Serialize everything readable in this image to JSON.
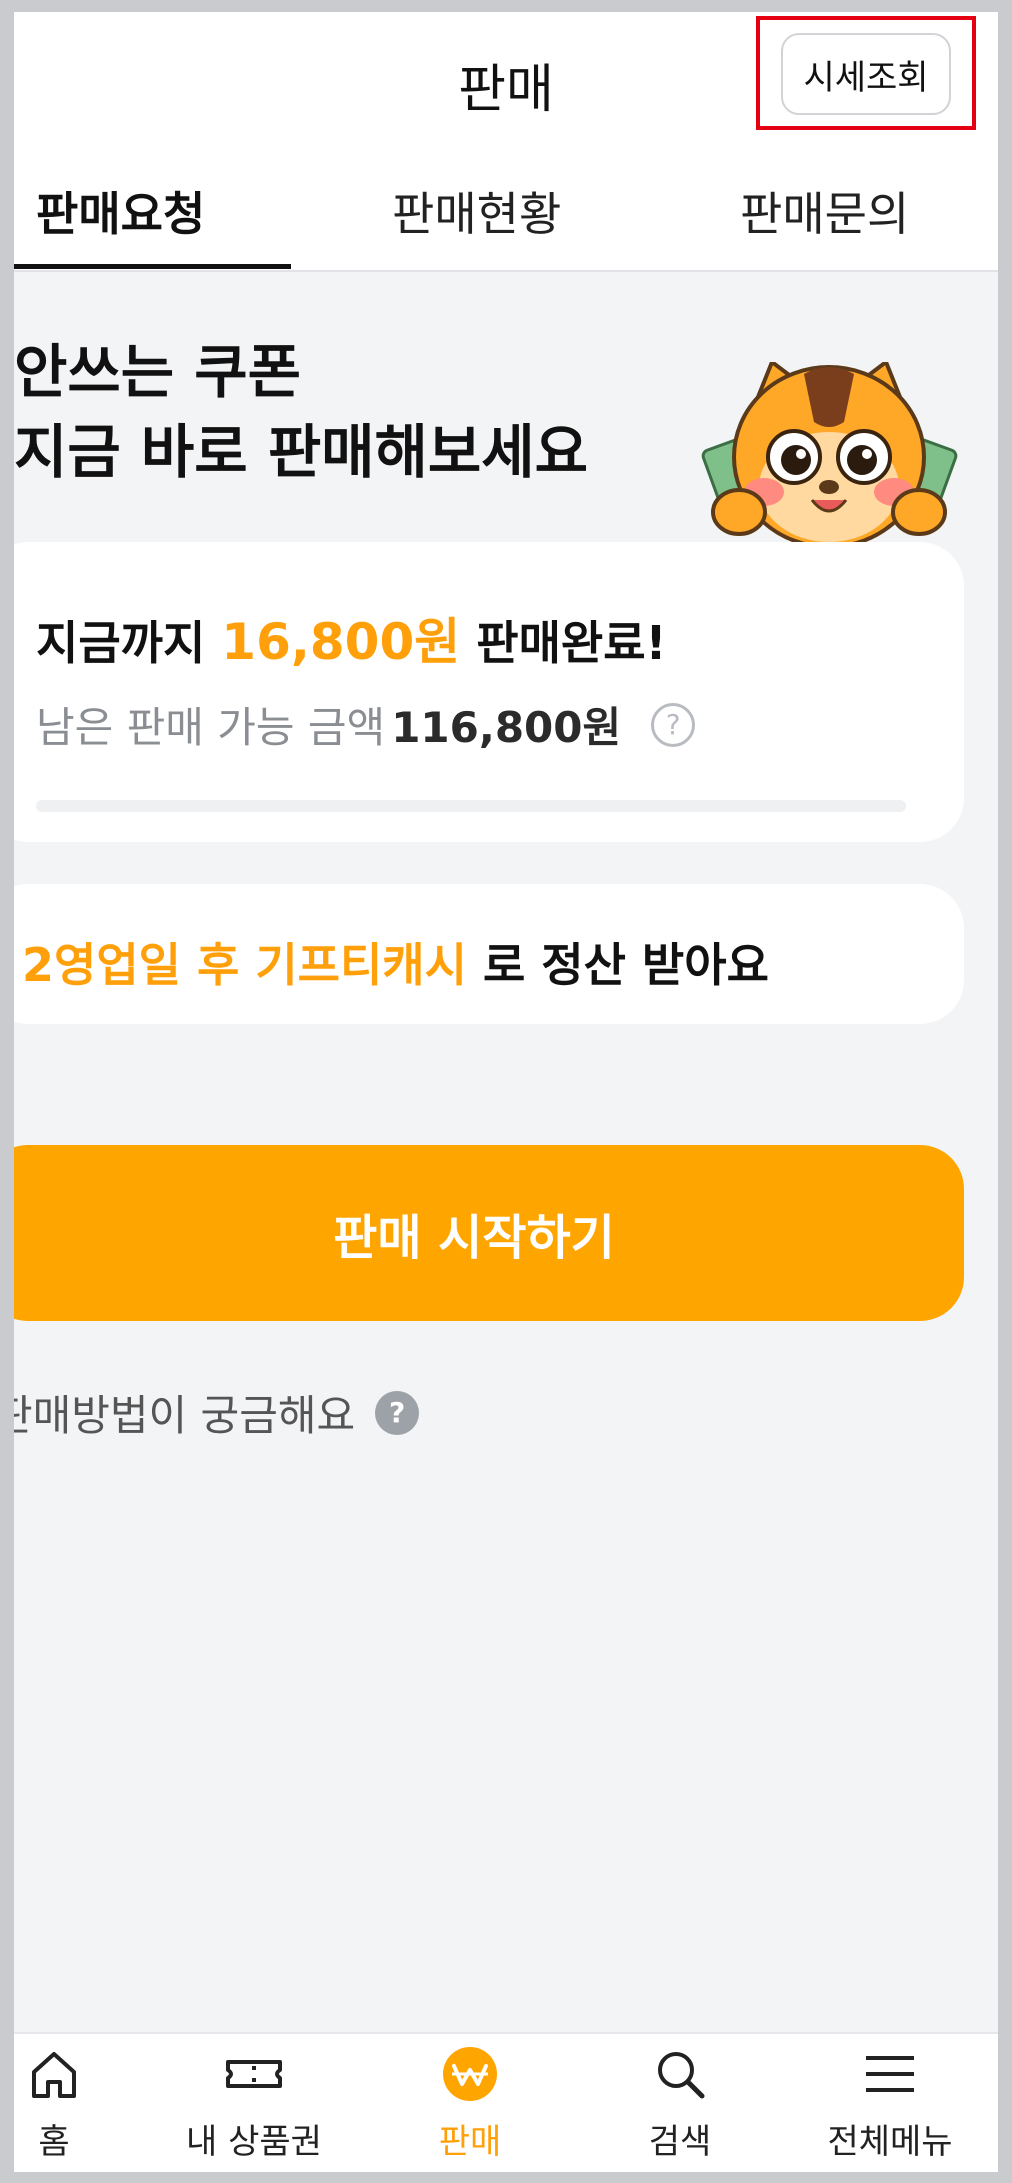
{
  "header": {
    "title": "판매",
    "price_check_label": "시세조회"
  },
  "tabs": [
    {
      "label": "판매요청",
      "active": true
    },
    {
      "label": "판매현황",
      "active": false
    },
    {
      "label": "판매문의",
      "active": false
    }
  ],
  "hero": {
    "line1": "안쓰는 쿠폰",
    "line2": "지금 바로 판매해보세요"
  },
  "summary_card": {
    "sold_prefix": "지금까지",
    "sold_amount": "16,800원",
    "sold_suffix": "판매완료!",
    "remaining_label": "남은 판매 가능 금액",
    "remaining_amount": "116,800원",
    "help_icon": "question-icon",
    "progress": 0.0
  },
  "settlement_card": {
    "highlight": "2영업일 후 기프티캐시",
    "rest": "로 정산 받아요"
  },
  "start_button": {
    "label": "판매 시작하기"
  },
  "how_to": {
    "label": "판매방법이 궁금해요",
    "icon": "question-icon"
  },
  "bottom_nav": [
    {
      "label": "홈",
      "icon": "home-icon",
      "active": false
    },
    {
      "label": "내 상품권",
      "icon": "ticket-icon",
      "active": false
    },
    {
      "label": "판매",
      "icon": "won-icon",
      "active": true
    },
    {
      "label": "검색",
      "icon": "search-icon",
      "active": false
    },
    {
      "label": "전체메뉴",
      "icon": "menu-icon",
      "active": false
    }
  ],
  "colors": {
    "accent": "#ffa500",
    "accent_text": "#ff9f0a",
    "highlight_box": "#e40012"
  }
}
